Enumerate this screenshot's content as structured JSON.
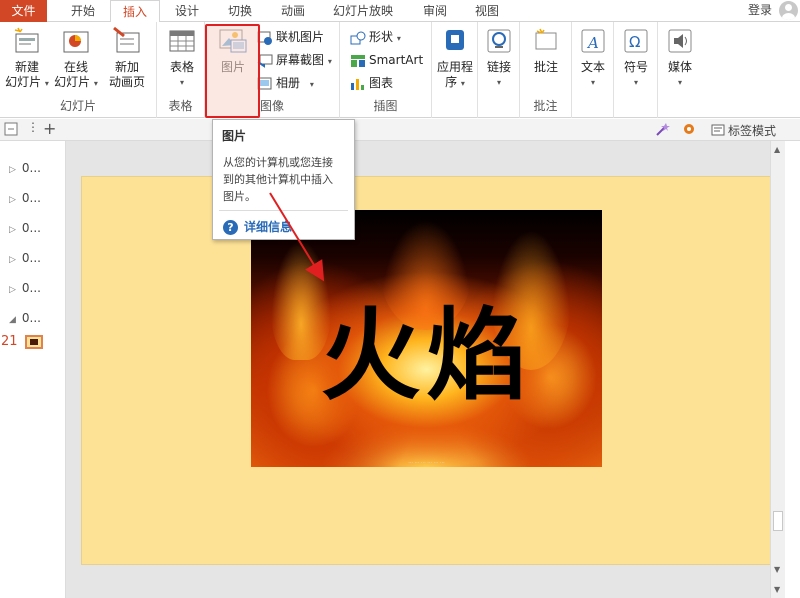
{
  "tabs": [
    "文件",
    "开始",
    "插入",
    "设计",
    "切换",
    "动画",
    "幻灯片放映",
    "审阅",
    "视图"
  ],
  "active_tab": "插入",
  "login": "登录",
  "ribbon": {
    "slides_group": {
      "label": "幻灯片",
      "new_slide": [
        "新建",
        "幻灯片"
      ],
      "online_slide": [
        "在线",
        "幻灯片"
      ],
      "add_anim_page": [
        "新加",
        "动画页"
      ]
    },
    "table_group": {
      "label": "表格",
      "table": "表格"
    },
    "image_group": {
      "label": "图像",
      "picture": "图片",
      "online_picture": "联机图片",
      "screenshot": "屏幕截图",
      "album": "相册"
    },
    "illustration_group": {
      "label": "插图",
      "shapes": "形状",
      "smartart": "SmartArt",
      "chart": "图表"
    },
    "apps_group": {
      "apps": [
        "应用程",
        "序"
      ]
    },
    "link_group": {
      "link": "链接"
    },
    "comment_group": {
      "label": "批注",
      "comment": "批注"
    },
    "text_group": {
      "text": "文本"
    },
    "symbol_group": {
      "symbol": "符号"
    },
    "media_group": {
      "media": "媒体"
    }
  },
  "toolbar": {
    "tag_mode": "标签模式"
  },
  "sections": [
    {
      "label": "0..."
    },
    {
      "label": "0..."
    },
    {
      "label": "0..."
    },
    {
      "label": "0..."
    },
    {
      "label": "0..."
    },
    {
      "label": "0..."
    }
  ],
  "current_slide_number": "21",
  "tooltip": {
    "title": "图片",
    "lines": [
      "从您的计算机或您连接",
      "到的其他计算机中插入",
      "图片。"
    ],
    "help": "详细信息"
  },
  "slide_content": {
    "calligraphy": "火焰"
  },
  "colors": {
    "accent": "#d24726",
    "slide_background": "#fde296",
    "highlight_box": "#e02020",
    "help_link": "#2a6bb8"
  }
}
